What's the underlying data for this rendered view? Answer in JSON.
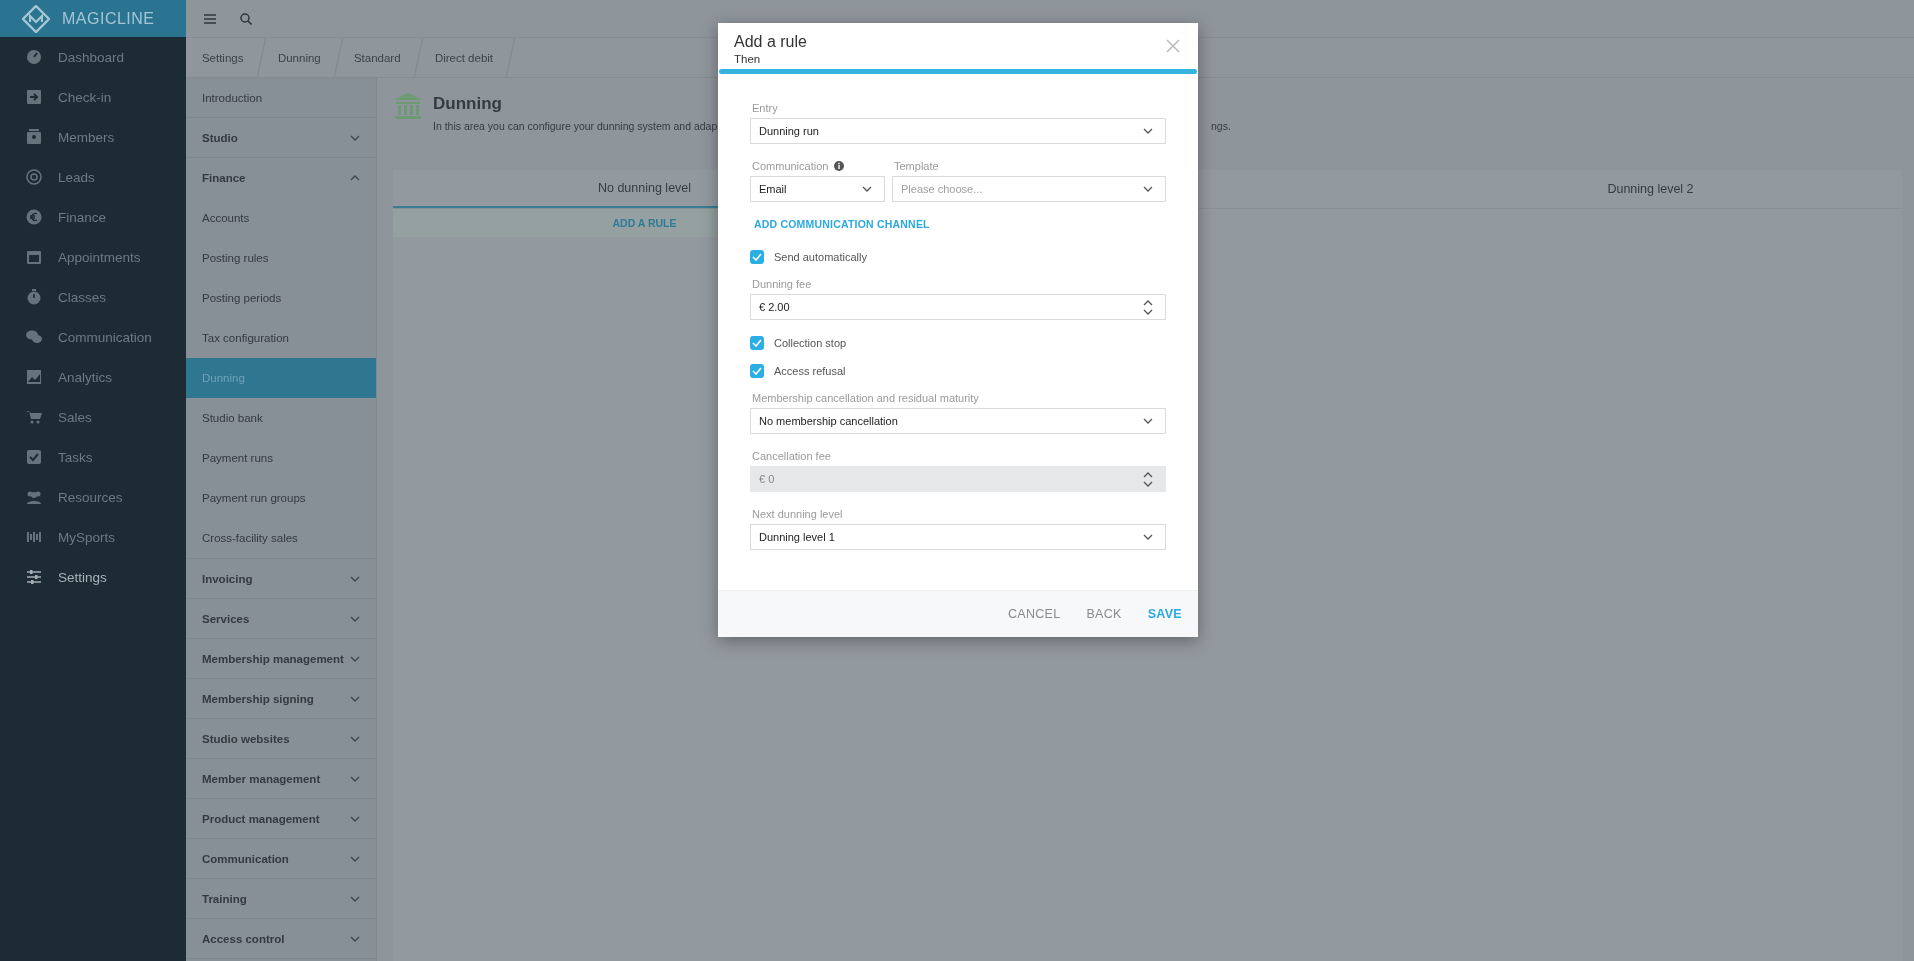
{
  "app": {
    "logo": "MAGICLINE"
  },
  "nav": [
    {
      "label": "Dashboard",
      "selected": false
    },
    {
      "label": "Check-in",
      "selected": false
    },
    {
      "label": "Members",
      "selected": false
    },
    {
      "label": "Leads",
      "selected": false
    },
    {
      "label": "Finance",
      "selected": false
    },
    {
      "label": "Appointments",
      "selected": false
    },
    {
      "label": "Classes",
      "selected": false
    },
    {
      "label": "Communication",
      "selected": false
    },
    {
      "label": "Analytics",
      "selected": false
    },
    {
      "label": "Sales",
      "selected": false
    },
    {
      "label": "Tasks",
      "selected": false
    },
    {
      "label": "Resources",
      "selected": false
    },
    {
      "label": "MySports",
      "selected": false
    },
    {
      "label": "Settings",
      "selected": true
    }
  ],
  "breadcrumbs": [
    "Settings",
    "Dunning",
    "Standard",
    "Direct debit"
  ],
  "submenu": [
    {
      "kind": "link",
      "label": "Introduction",
      "selected": false
    },
    {
      "kind": "group",
      "label": "Studio",
      "expanded": false
    },
    {
      "kind": "group",
      "label": "Finance",
      "expanded": true,
      "children": [
        {
          "label": "Accounts",
          "selected": false
        },
        {
          "label": "Posting rules",
          "selected": false
        },
        {
          "label": "Posting periods",
          "selected": false
        },
        {
          "label": "Tax configuration",
          "selected": false
        },
        {
          "label": "Dunning",
          "selected": true
        },
        {
          "label": "Studio bank",
          "selected": false
        },
        {
          "label": "Payment runs",
          "selected": false
        },
        {
          "label": "Payment run groups",
          "selected": false
        },
        {
          "label": "Cross-facility sales",
          "selected": false
        }
      ]
    },
    {
      "kind": "group",
      "label": "Invoicing",
      "expanded": false
    },
    {
      "kind": "group",
      "label": "Services",
      "expanded": false
    },
    {
      "kind": "group",
      "label": "Membership management",
      "expanded": false
    },
    {
      "kind": "group",
      "label": "Membership signing",
      "expanded": false
    },
    {
      "kind": "group",
      "label": "Studio websites",
      "expanded": false
    },
    {
      "kind": "group",
      "label": "Member management",
      "expanded": false
    },
    {
      "kind": "group",
      "label": "Product management",
      "expanded": false
    },
    {
      "kind": "group",
      "label": "Communication",
      "expanded": false
    },
    {
      "kind": "group",
      "label": "Training",
      "expanded": false
    },
    {
      "kind": "group",
      "label": "Access control",
      "expanded": false
    }
  ],
  "page": {
    "title": "Dunning",
    "description_left": "In this area you can configure your dunning system and adap",
    "description_right": "ngs."
  },
  "tabs": [
    {
      "label": "No dunning level",
      "selected": true
    },
    {
      "label": "Dunning level 2",
      "selected": false
    }
  ],
  "add_rule": "ADD A RULE",
  "dialog": {
    "title": "Add a rule",
    "subtitle": "Then",
    "fields": [
      {
        "kind": "select",
        "label": "Entry",
        "value": "Dunning run"
      },
      {
        "kind": "select_pair",
        "left": {
          "label": "Communication",
          "info": true,
          "value": "Email"
        },
        "right": {
          "label": "Template",
          "placeholder": "Please choose..."
        }
      },
      {
        "kind": "link",
        "label": "ADD COMMUNICATION CHANNEL"
      },
      {
        "kind": "checkbox",
        "label": "Send automatically",
        "checked": true
      },
      {
        "kind": "number",
        "label": "Dunning fee",
        "value": "€ 2.00",
        "disabled": false
      },
      {
        "kind": "checkbox",
        "label": "Collection stop",
        "checked": true
      },
      {
        "kind": "checkbox",
        "label": "Access refusal",
        "checked": true
      },
      {
        "kind": "select",
        "label": "Membership cancellation and residual maturity",
        "value": "No membership cancellation"
      },
      {
        "kind": "number",
        "label": "Cancellation fee",
        "value": "€ 0",
        "disabled": true
      },
      {
        "kind": "select",
        "label": "Next dunning level",
        "value": "Dunning level 1"
      }
    ],
    "buttons": [
      {
        "label": "CANCEL",
        "primary": false
      },
      {
        "label": "BACK",
        "primary": false
      },
      {
        "label": "SAVE",
        "primary": true
      }
    ]
  }
}
